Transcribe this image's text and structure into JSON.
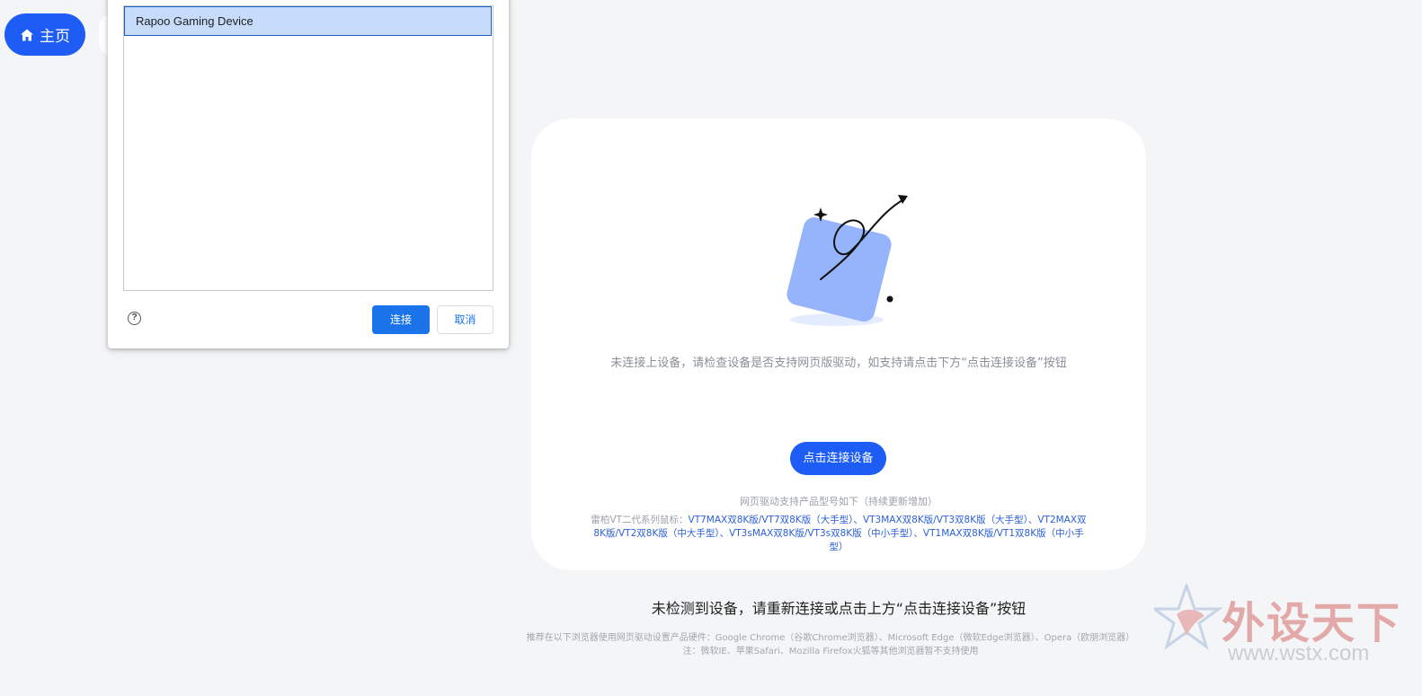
{
  "nav": {
    "home_label": "主页",
    "home_icon": "home-icon"
  },
  "device_dialog": {
    "devices": [
      "Rapoo Gaming Device"
    ],
    "help_icon": "question-circle-icon",
    "help_glyph": "?",
    "connect_label": "连接",
    "cancel_label": "取消"
  },
  "card": {
    "message": "未连接上设备，请检查设备是否支持网页版驱动，如支持请点击下方“点击连接设备”按钮",
    "connect_button": "点击连接设备",
    "support_title": "网页驱动支持产品型号如下（持续更新增加）",
    "support_prefix": "雷柏VT二代系列鼠标：",
    "support_models": "VT7MAX双8K版/VT7双8K版（大手型）、VT3MAX双8K版/VT3双8K版（大手型）、VT2MAX双8K版/VT2双8K版（中大手型）、VT3sMAX双8K版/VT3s双8K版（中小手型）、VT1MAX双8K版/VT1双8K版（中小手型）"
  },
  "footer": {
    "no_device": "未检测到设备，请重新连接或点击上方“点击连接设备”按钮",
    "recommend": "推荐在以下浏览器使用网页驱动设置产品硬件：Google Chrome（谷歌Chrome浏览器）、Microsoft Edge（微软Edge浏览器）、Opera（欧朋浏览器）",
    "note": "注：微软IE、苹果Safari、Mozilla Firefox火狐等其他浏览器暂不支持使用"
  },
  "watermark": {
    "brand": "外设天下",
    "url": "www.wstx.com"
  },
  "colors": {
    "primary": "#1d5cf5",
    "dialog_primary": "#1a73e8",
    "background": "#f4f5f7"
  }
}
